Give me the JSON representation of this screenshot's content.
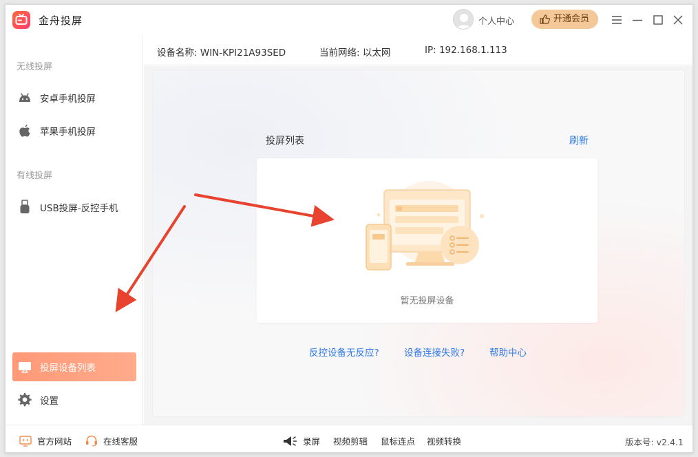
{
  "app": {
    "title": "金舟投屏"
  },
  "header": {
    "user_center": "个人中心",
    "vip_button": "开通会员"
  },
  "sidebar": {
    "wireless_section": "无线投屏",
    "wired_section": "有线投屏",
    "items": [
      {
        "label": "安卓手机投屏",
        "icon": "android-icon"
      },
      {
        "label": "苹果手机投屏",
        "icon": "apple-icon"
      },
      {
        "label": "USB投屏-反控手机",
        "icon": "usb-icon"
      },
      {
        "label": "投屏设备列表",
        "icon": "screen-cast-icon",
        "active": true
      },
      {
        "label": "设置",
        "icon": "gear-icon"
      }
    ]
  },
  "device_info": {
    "name": "设备名称: WIN-KPI21A93SED",
    "network": "当前网络:  以太网",
    "ip": "IP: 192.168.1.113"
  },
  "cast_list": {
    "title": "投屏列表",
    "refresh": "刷新",
    "empty_text": "暂无投屏设备"
  },
  "help_links": {
    "no_response": "反控设备无反应?",
    "connect_failed": "设备连接失败?",
    "help_center": "帮助中心"
  },
  "footer": {
    "official_site": "官方网站",
    "online_service": "在线客服",
    "record": "录屏",
    "video_edit": "视频剪辑",
    "mouse_clicker": "鼠标连点",
    "video_convert": "视频转换",
    "version": "版本号: v2.4.1"
  },
  "colors": {
    "accent_orange": "#ff9977",
    "link_blue": "#2f7be8",
    "vip_gold": "#f5c89a",
    "arrow_red": "#e8432e"
  }
}
